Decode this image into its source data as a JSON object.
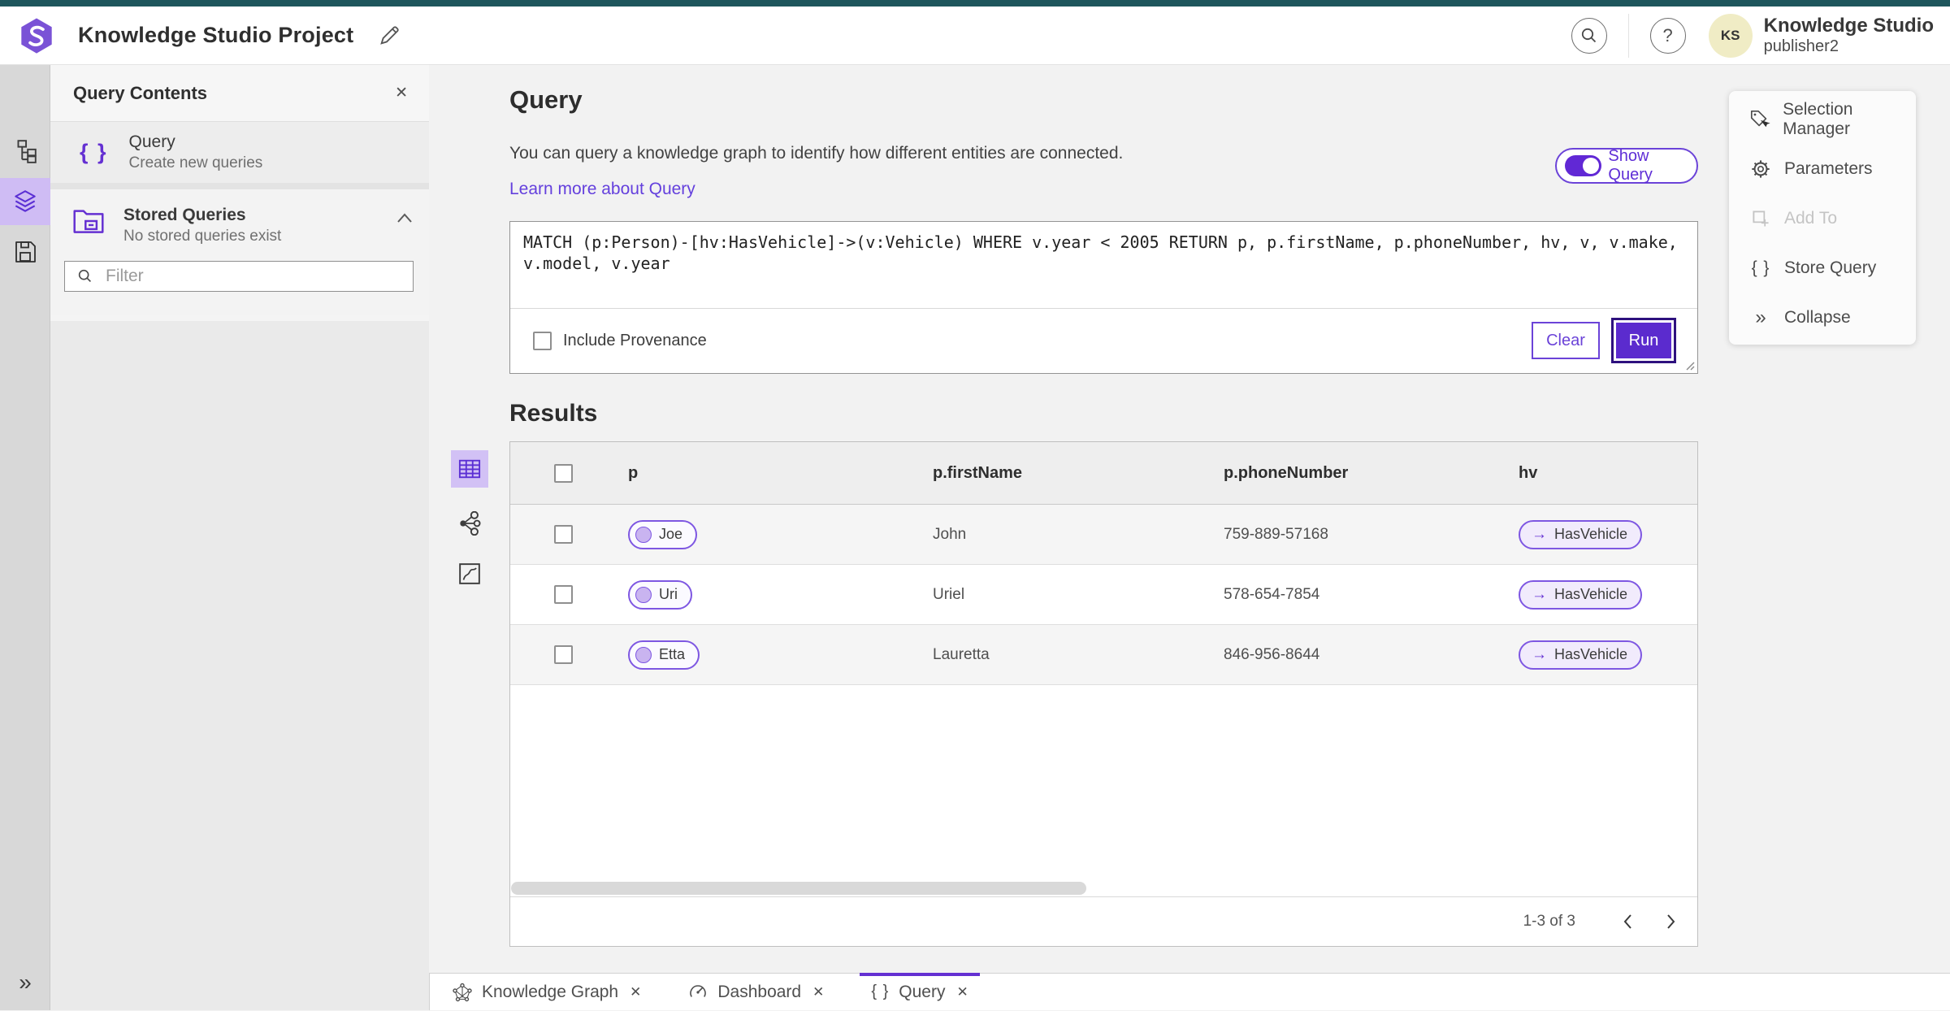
{
  "chrome": {
    "app_title": "Knowledge Studio Project",
    "user": {
      "initials": "KS",
      "name": "Knowledge Studio",
      "subtitle": "publisher2"
    },
    "help_glyph": "?"
  },
  "left_panel": {
    "title": "Query Contents",
    "query_item": {
      "title": "Query",
      "subtitle": "Create new queries"
    },
    "stored": {
      "title": "Stored Queries",
      "subtitle": "No stored queries exist"
    },
    "filter_placeholder": "Filter"
  },
  "query_section": {
    "title": "Query",
    "description": "You can query a knowledge graph to identify how different entities are connected.",
    "learn_more": "Learn more about Query",
    "show_query_label": "Show Query",
    "query_text": "MATCH (p:Person)-[hv:HasVehicle]->(v:Vehicle) WHERE v.year < 2005 RETURN p, p.firstName, p.phoneNumber, hv, v, v.make, v.model, v.year",
    "include_provenance_label": "Include Provenance",
    "clear_label": "Clear",
    "run_label": "Run"
  },
  "results": {
    "title": "Results",
    "columns": [
      "p",
      "p.firstName",
      "p.phoneNumber",
      "hv"
    ],
    "rows": [
      {
        "p": "Joe",
        "firstName": "John",
        "phoneNumber": "759-889-57168",
        "hv": "HasVehicle"
      },
      {
        "p": "Uri",
        "firstName": "Uriel",
        "phoneNumber": "578-654-7854",
        "hv": "HasVehicle"
      },
      {
        "p": "Etta",
        "firstName": "Lauretta",
        "phoneNumber": "846-956-8644",
        "hv": "HasVehicle"
      }
    ],
    "edge_arrow": "→",
    "pagination": {
      "range": "1-3 of 3"
    }
  },
  "right_panel": {
    "items": [
      {
        "label": "Selection Manager",
        "disabled": false
      },
      {
        "label": "Parameters",
        "disabled": false
      },
      {
        "label": "Add To",
        "disabled": true
      },
      {
        "label": "Store Query",
        "disabled": false
      },
      {
        "label": "Collapse",
        "disabled": false
      }
    ]
  },
  "tab_bar": {
    "tabs": [
      {
        "label": "Knowledge Graph",
        "active": false
      },
      {
        "label": "Dashboard",
        "active": false
      },
      {
        "label": "Query",
        "active": true
      }
    ]
  },
  "glyphs": {
    "braces": "{ }",
    "close": "✕",
    "collapse": "»"
  },
  "colors": {
    "accent_purple": "#6430d2",
    "top_bar_teal": "#1e565c",
    "avatar_bg": "#f0ecc5",
    "rail_highlight": "#cfbcf4",
    "run_button": "#5b2bce"
  },
  "icons": [
    "app-logo-icon",
    "edit-pencil-icon",
    "search-icon",
    "help-icon",
    "tree-view-icon",
    "layers-icon",
    "save-icon",
    "collapse-rail-icon",
    "close-icon",
    "braces-icon",
    "stored-queries-folder-icon",
    "chevron-up-icon",
    "filter-search-icon",
    "resize-handle-icon",
    "table-view-icon",
    "graph-view-icon",
    "chart-view-icon",
    "selection-manager-icon",
    "parameters-gear-icon",
    "add-to-icon",
    "store-query-icon",
    "collapse-icon",
    "knowledge-graph-icon",
    "dashboard-icon",
    "arrow-right-icon",
    "chevron-left-icon",
    "chevron-right-icon"
  ]
}
